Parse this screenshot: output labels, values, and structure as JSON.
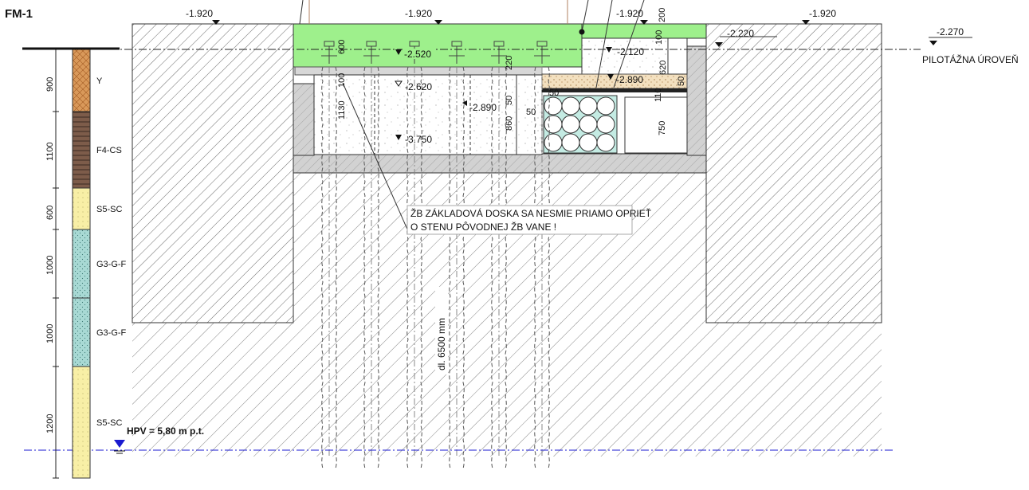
{
  "drawing": {
    "title": "FM-1",
    "pile_level_label": "PILOTÁŽNA ÚROVEŇ",
    "note_line1": "ŽB ZÁKLADOVÁ DOSKA SA NESMIE PRIAMO OPRIEŤ",
    "note_line2": "O STENU PÔVODNEJ ŽB VANE !",
    "pile_length": "dl. 6500 mm",
    "groundwater": "HPV = 5,80 m p.t."
  },
  "levels": {
    "top_left": "-1.920",
    "top_center": "-1.920",
    "top_right_mid": "-1.920",
    "top_far_right": "-1.920",
    "right_2220": "-2.220",
    "pile_level": "-2.270",
    "slab_2520": "-2.520",
    "slab_2620": "-2.620",
    "pit_2890": "-2.890",
    "right_2120": "-2.120",
    "right_2890": "-2.890",
    "bottom_3750": "-3.750"
  },
  "dims": {
    "d600": "600",
    "d100": "100",
    "d1130": "1130",
    "d220": "220",
    "d50a": "50",
    "d50b": "50",
    "d50c": "50",
    "d860": "860",
    "d200": "200",
    "d100r": "100",
    "d620": "620",
    "d50r": "50",
    "d110": "110",
    "d750": "750"
  },
  "borehole": {
    "layers": [
      {
        "thickness": "900",
        "code": "Y",
        "color": "#d99a5b"
      },
      {
        "thickness": "1100",
        "code": "F4-CS",
        "color": "#7a5a48"
      },
      {
        "thickness": "600",
        "code": "S5-SC",
        "color": "#f7eea0"
      },
      {
        "thickness": "1000",
        "code": "G3-G-F",
        "color": "#a9d8d4"
      },
      {
        "thickness": "1000",
        "code": "G3-G-F",
        "color": "#a9d8d4"
      },
      {
        "thickness": "1200",
        "code": "S5-SC",
        "color": "#f7eea0"
      }
    ]
  },
  "colors": {
    "concrete_green": "#9ef08c",
    "gravel": "#d7d7d7",
    "sand": "#f2e2c4",
    "water_line": "#1a1ad0"
  }
}
